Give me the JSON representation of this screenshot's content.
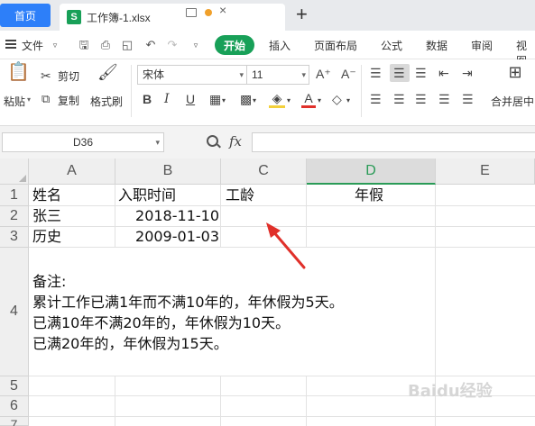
{
  "tabs": {
    "home_label": "首页",
    "file_icon": "S",
    "file_name": "工作簿-1.xlsx",
    "close_label": "×",
    "add_label": "+"
  },
  "menubar": {
    "file_label": "文件",
    "start_label": "开始",
    "items": [
      "插入",
      "页面布局",
      "公式",
      "数据",
      "审阅",
      "视图"
    ]
  },
  "ribbon": {
    "paste_label": "粘贴",
    "cut_label": "剪切",
    "copy_label": "复制",
    "format_painter_label": "格式刷",
    "font_name": "宋体",
    "font_size": "11",
    "bold": "B",
    "italic": "I",
    "underline": "U",
    "font_color_glyph": "A",
    "merge_label": "合并居中"
  },
  "formula_bar": {
    "name_box": "D36",
    "fx_label": "fx",
    "formula": ""
  },
  "sheet": {
    "columns": [
      "A",
      "B",
      "C",
      "D",
      "E"
    ],
    "selected_column": "D",
    "rows": [
      "1",
      "2",
      "3",
      "4",
      "5",
      "6",
      "7"
    ],
    "cells": {
      "A1": "姓名",
      "B1": "入职时间",
      "C1": "工龄",
      "D1": "年假",
      "A2": "张三",
      "B2": "2018-11-10",
      "A3": "历史",
      "B3": "2009-01-03"
    },
    "note_lines": [
      "备注:",
      "累计工作已满1年而不满10年的，年休假为5天。",
      "已满10年不满20年的，年休假为10天。",
      "已满20年的，年休假为15天。"
    ]
  },
  "watermark": "Baidu经验",
  "colors": {
    "accent_green": "#18a058",
    "home_blue": "#2d7ff9",
    "arrow_red": "#e0302a"
  }
}
